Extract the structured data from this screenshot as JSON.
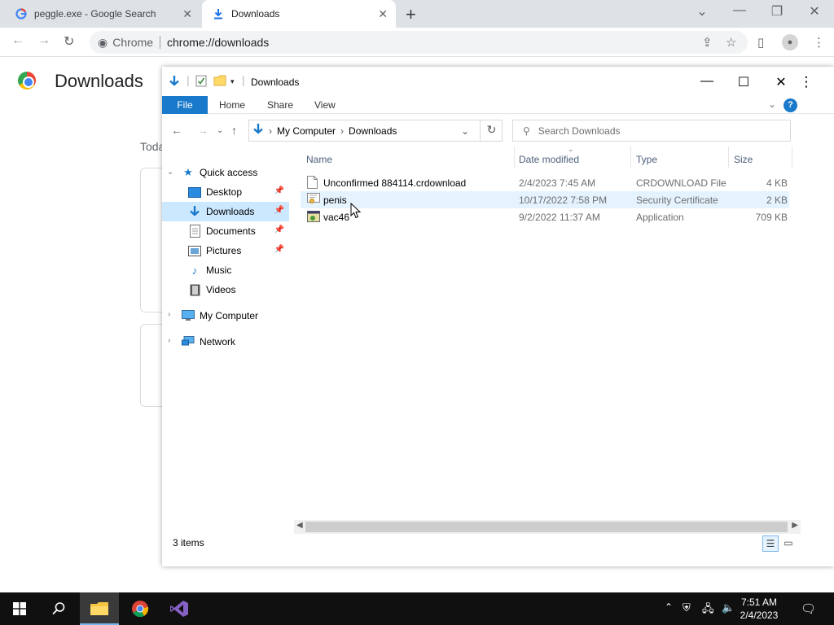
{
  "chrome": {
    "tabs": [
      {
        "title": "peggle.exe - Google Search",
        "favicon": "google-g-icon"
      },
      {
        "title": "Downloads",
        "favicon": "download-arrow-icon"
      }
    ],
    "omnibox": {
      "scheme_label": "Chrome",
      "url": "chrome://downloads"
    },
    "page": {
      "title": "Downloads",
      "today_label": "Toda"
    }
  },
  "explorer": {
    "title": "Downloads",
    "ribbon": {
      "file": "File",
      "home": "Home",
      "share": "Share",
      "view": "View",
      "help": "?"
    },
    "address": {
      "crumbs": [
        "My Computer",
        "Downloads"
      ]
    },
    "search": {
      "placeholder": "Search Downloads"
    },
    "nav": {
      "quick_access": "Quick access",
      "items": [
        {
          "label": "Desktop",
          "pinned": true
        },
        {
          "label": "Downloads",
          "pinned": true,
          "selected": true
        },
        {
          "label": "Documents",
          "pinned": true
        },
        {
          "label": "Pictures",
          "pinned": true
        },
        {
          "label": "Music",
          "pinned": false
        },
        {
          "label": "Videos",
          "pinned": false
        }
      ],
      "my_computer": "My Computer",
      "network": "Network"
    },
    "columns": {
      "name": "Name",
      "date": "Date modified",
      "type": "Type",
      "size": "Size"
    },
    "files": [
      {
        "name": "Unconfirmed 884114.crdownload",
        "date": "2/4/2023 7:45 AM",
        "type": "CRDOWNLOAD File",
        "size": "4 KB",
        "icon": "blank-file-icon"
      },
      {
        "name": "penis",
        "date": "10/17/2022 7:58 PM",
        "type": "Security Certificate",
        "size": "2 KB",
        "icon": "certificate-icon"
      },
      {
        "name": "vac46",
        "date": "9/2/2022 11:37 AM",
        "type": "Application",
        "size": "709 KB",
        "icon": "application-icon"
      }
    ],
    "status": {
      "item_count": "3 items"
    }
  },
  "taskbar": {
    "clock": {
      "time": "7:51 AM",
      "date": "2/4/2023"
    }
  },
  "colors": {
    "accent_blue": "#1979ca",
    "selection": "#cce8ff",
    "hover": "#e5f3ff",
    "taskbar": "#101010"
  }
}
